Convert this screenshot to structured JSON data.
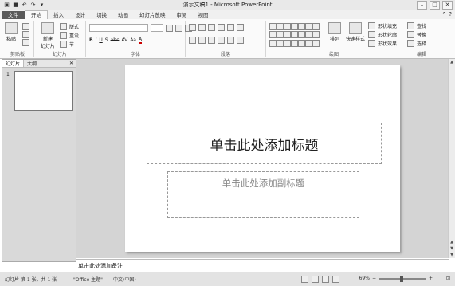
{
  "window": {
    "title": "演示文稿1 - Microsoft PowerPoint"
  },
  "quick_access": [
    "save-icon",
    "undo-icon",
    "redo-icon",
    "customize-icon"
  ],
  "tabs": [
    {
      "label": "文件"
    },
    {
      "label": "开始"
    },
    {
      "label": "插入"
    },
    {
      "label": "设计"
    },
    {
      "label": "切换"
    },
    {
      "label": "动画"
    },
    {
      "label": "幻灯片放映"
    },
    {
      "label": "审阅"
    },
    {
      "label": "视图"
    }
  ],
  "ribbon": {
    "clipboard": {
      "label": "剪贴板",
      "paste": "粘贴"
    },
    "slides": {
      "label": "幻灯片",
      "new_slide": "新建",
      "new_slide2": "幻灯片",
      "layout": "版式",
      "reset": "重设",
      "section": "节"
    },
    "font": {
      "label": "字体"
    },
    "paragraph": {
      "label": "段落"
    },
    "drawing": {
      "label": "绘图",
      "arrange": "排列",
      "quick_styles": "快速样式",
      "fill": "形状填充",
      "outline": "形状轮廓",
      "effects": "形状效果"
    },
    "editing": {
      "label": "编辑",
      "find": "查找",
      "replace": "替换",
      "select": "选择"
    }
  },
  "pane": {
    "tab_slides": "幻灯片",
    "tab_outline": "大纲",
    "slide_number": "1"
  },
  "slide": {
    "title_placeholder": "单击此处添加标题",
    "subtitle_placeholder": "单击此处添加副标题"
  },
  "notes": {
    "placeholder": "单击此处添加备注"
  },
  "status": {
    "slide_info": "幻灯片 第 1 张，共 1 张",
    "theme": "\"Office 主题\"",
    "language": "中文(中国)",
    "zoom": "69%"
  }
}
